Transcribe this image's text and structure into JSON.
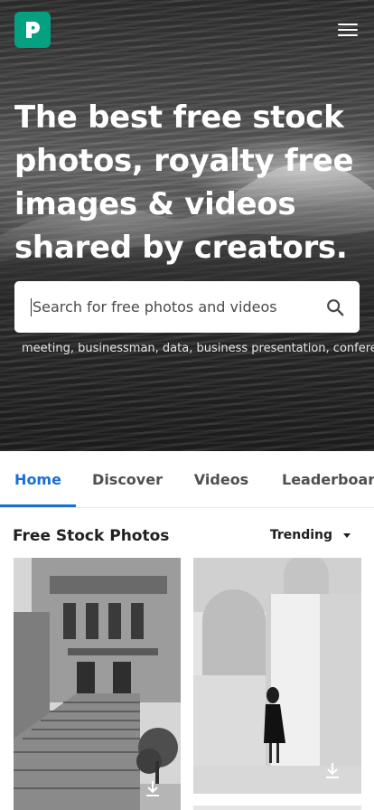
{
  "header": {
    "logo_icon": "pexels-logo-icon",
    "menu_icon": "hamburger-menu-icon",
    "brand_color": "#05a081"
  },
  "hero": {
    "headline_lines": [
      "The best free stock",
      "photos, royalty free",
      "images & videos",
      "shared by creators."
    ],
    "search_placeholder": "Search for free photos and videos",
    "search_value": "",
    "suggestions": "meeting, businessman, data, business presentation, conference"
  },
  "tabs": [
    {
      "label": "Home",
      "active": true
    },
    {
      "label": "Discover",
      "active": false
    },
    {
      "label": "Videos",
      "active": false
    },
    {
      "label": "Leaderboard",
      "active": false
    }
  ],
  "main": {
    "section_title": "Free Stock Photos",
    "sort_label": "Trending"
  },
  "photos": [
    {
      "subject": "black-and-white building with stairs",
      "download_icon": "download-icon"
    },
    {
      "subject": "woman near white pillars",
      "download_icon": "download-icon"
    }
  ],
  "colors": {
    "active_tab": "#1a6fd6",
    "tab_text": "#4f4f4f"
  }
}
